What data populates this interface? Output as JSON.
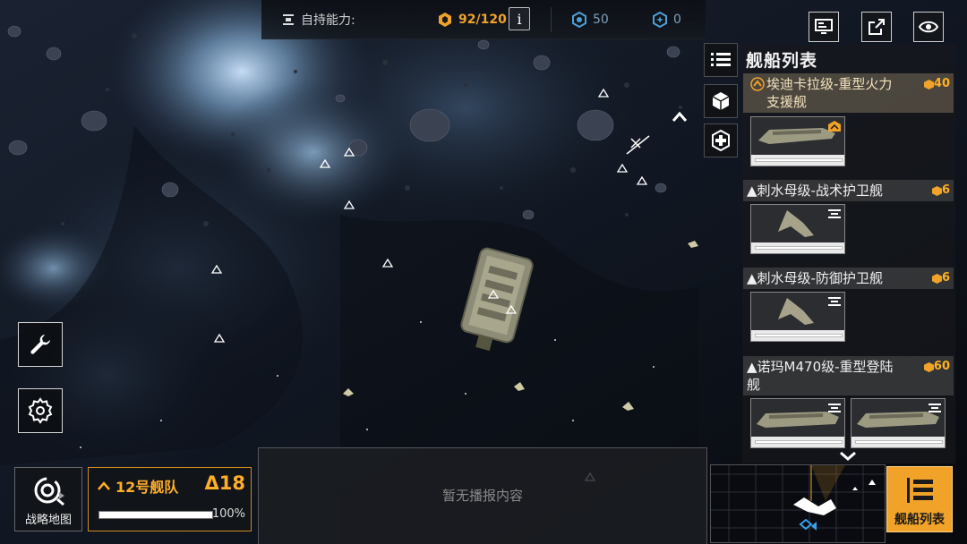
{
  "topbar": {
    "self_sustain_label": "自持能力:",
    "command_points": "92/120",
    "info_label": "i",
    "resource_a": "50",
    "resource_b": "0"
  },
  "panel": {
    "title": "舰船列表",
    "entries": [
      {
        "name_line1": "埃迪卡拉级-重型火力",
        "name_line2": "支援舰",
        "cost": "40"
      },
      {
        "name": "▲刺水母级-战术护卫舰",
        "cost": "6"
      },
      {
        "name": "▲刺水母级-防御护卫舰",
        "cost": "6"
      },
      {
        "name_line1": "▲诺玛M470级-重型登陆",
        "name_line2": "舰",
        "cost": "60"
      }
    ]
  },
  "bottom": {
    "map_label": "战略地图",
    "fleet_name": "12号舰队",
    "fleet_points": "Δ18",
    "fleet_hp_percent": "100%",
    "fleet_hp_fraction": 1.0,
    "broadcast_text": "暂无播报内容",
    "fleet_list_label": "舰船列表"
  },
  "colors": {
    "accent": "#f0a229",
    "resource_blue": "#4d9fd8",
    "panel_bg": "#16181c"
  },
  "icons": [
    "wrench-icon",
    "gear-icon",
    "list-icon",
    "cube-icon",
    "repair-icon",
    "chevron-up-icon",
    "monitor-icon",
    "external-link-icon",
    "eye-icon",
    "chevron-down-icon"
  ]
}
